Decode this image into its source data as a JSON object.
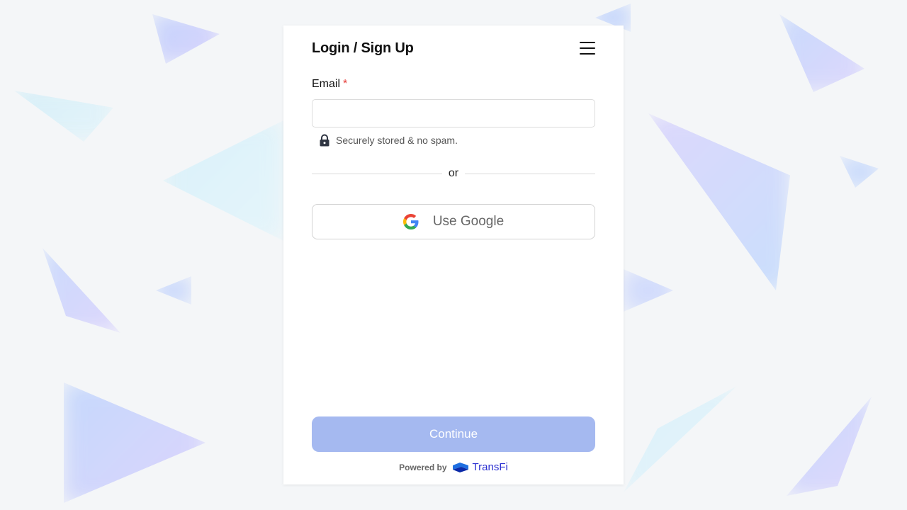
{
  "header": {
    "title": "Login / Sign Up",
    "menu_icon": "hamburger-menu-icon"
  },
  "form": {
    "email_label": "Email",
    "required_marker": "*",
    "email_value": "",
    "email_placeholder": "",
    "secure_note": "Securely stored & no spam.",
    "lock_icon": "lock-icon"
  },
  "divider": {
    "text": "or"
  },
  "google": {
    "label": "Use Google",
    "icon": "google-logo-icon"
  },
  "footer": {
    "continue_label": "Continue",
    "powered_by": "Powered by",
    "brand_name": "TransFi",
    "brand_logo": "transfi-logo-icon"
  },
  "colors": {
    "continue_button": "#a5b9f0",
    "required_marker": "#e53935",
    "brand_text": "#2a2fd1"
  }
}
